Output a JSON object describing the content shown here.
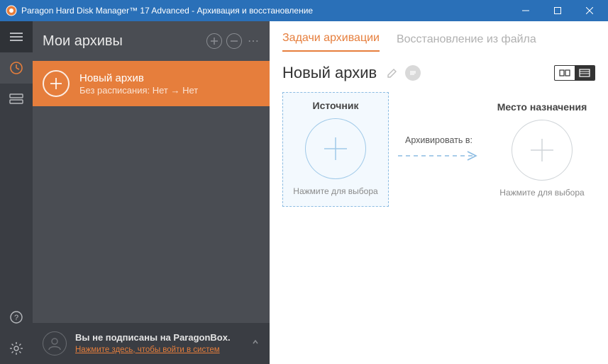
{
  "titlebar": {
    "title": "Paragon Hard Disk Manager™ 17 Advanced - Архивация и восстановление"
  },
  "sidebar": {
    "heading": "Мои архивы",
    "item": {
      "name": "Новый архив",
      "sub": "Без расписания: Нет → Нет"
    }
  },
  "footer": {
    "line1": "Вы не подписаны на ParagonBox.",
    "line2": "Нажмите здесь, чтобы войти в систем"
  },
  "tabs": {
    "active": "Задачи архивации",
    "inactive": "Восстановление из файла"
  },
  "content": {
    "title": "Новый архив",
    "source_label": "Источник",
    "dest_label": "Место назначения",
    "arrow_label": "Архивировать в:",
    "hint": "Нажмите для выбора"
  },
  "colors": {
    "accent": "#e67e3c",
    "titlebar": "#2a70b8",
    "link_blue": "#8cbce2"
  }
}
